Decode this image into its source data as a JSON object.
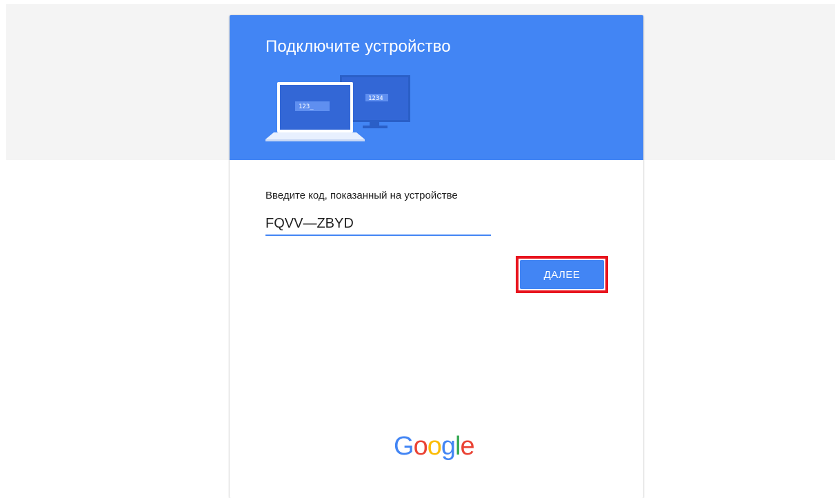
{
  "card": {
    "title": "Подключите устройство",
    "code_label": "Введите код, показанный на устройстве",
    "code_value": "FQVV—ZBYD",
    "next_label": "ДАЛЕЕ"
  },
  "illustration": {
    "laptop_code": "123_",
    "monitor_code": "1234"
  },
  "logo": {
    "letters": [
      "G",
      "o",
      "o",
      "g",
      "l",
      "e"
    ],
    "colors": [
      "#4285f4",
      "#ea4335",
      "#fbbc05",
      "#4285f4",
      "#34a853",
      "#ea4335"
    ]
  },
  "colors": {
    "primary": "#4285f4",
    "highlight": "#e8141e",
    "band": "#f4f4f4"
  }
}
